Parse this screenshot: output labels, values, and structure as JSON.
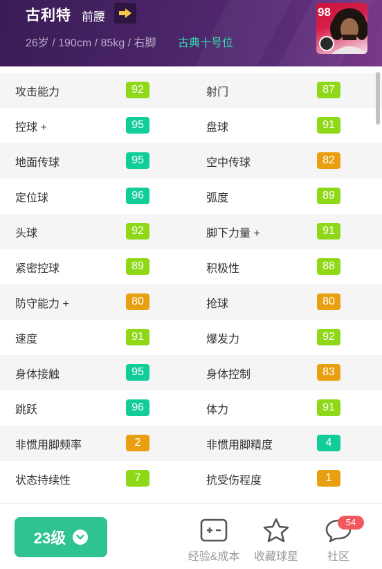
{
  "header": {
    "name": "古利特",
    "position": "前腰",
    "info": "26岁 / 190cm / 85kg / 右脚",
    "playstyle": "古典十号位",
    "card_rating": "98",
    "arrow_icon": "arrow-right-icon"
  },
  "stats": [
    {
      "left": {
        "label": "攻击能力",
        "value": "92",
        "color": "lime"
      },
      "right": {
        "label": "射门",
        "value": "87",
        "color": "lime"
      }
    },
    {
      "left": {
        "label": "控球 +",
        "value": "95",
        "color": "teal"
      },
      "right": {
        "label": "盘球",
        "value": "91",
        "color": "lime"
      }
    },
    {
      "left": {
        "label": "地面传球",
        "value": "95",
        "color": "teal"
      },
      "right": {
        "label": "空中传球",
        "value": "82",
        "color": "orange"
      }
    },
    {
      "left": {
        "label": "定位球",
        "value": "96",
        "color": "teal"
      },
      "right": {
        "label": "弧度",
        "value": "89",
        "color": "lime"
      }
    },
    {
      "left": {
        "label": "头球",
        "value": "92",
        "color": "lime"
      },
      "right": {
        "label": "脚下力量 +",
        "value": "91",
        "color": "lime"
      }
    },
    {
      "left": {
        "label": "紧密控球",
        "value": "89",
        "color": "lime"
      },
      "right": {
        "label": "积极性",
        "value": "88",
        "color": "lime"
      }
    },
    {
      "left": {
        "label": "防守能力 +",
        "value": "80",
        "color": "orange"
      },
      "right": {
        "label": "抢球",
        "value": "80",
        "color": "orange"
      }
    },
    {
      "left": {
        "label": "速度",
        "value": "91",
        "color": "lime"
      },
      "right": {
        "label": "爆发力",
        "value": "92",
        "color": "lime"
      }
    },
    {
      "left": {
        "label": "身体接触",
        "value": "95",
        "color": "teal"
      },
      "right": {
        "label": "身体控制",
        "value": "83",
        "color": "orange"
      }
    },
    {
      "left": {
        "label": "跳跃",
        "value": "96",
        "color": "teal"
      },
      "right": {
        "label": "体力",
        "value": "91",
        "color": "lime"
      }
    },
    {
      "left": {
        "label": "非惯用脚频率",
        "value": "2",
        "color": "orange"
      },
      "right": {
        "label": "非惯用脚精度",
        "value": "4",
        "color": "teal"
      }
    },
    {
      "left": {
        "label": "状态持续性",
        "value": "7",
        "color": "lime"
      },
      "right": {
        "label": "抗受伤程度",
        "value": "1",
        "color": "orange"
      }
    }
  ],
  "colors": {
    "lime": "#8fd818",
    "teal": "#12cc9a",
    "orange": "#e9a010",
    "level_button": "#2ec38f"
  },
  "bottom": {
    "level_label": "23级",
    "nav": [
      {
        "label": "经验&成本",
        "icon": "plus-minus-icon"
      },
      {
        "label": "收藏球星",
        "icon": "star-icon"
      },
      {
        "label": "社区",
        "icon": "chat-icon",
        "badge": "54"
      }
    ]
  }
}
